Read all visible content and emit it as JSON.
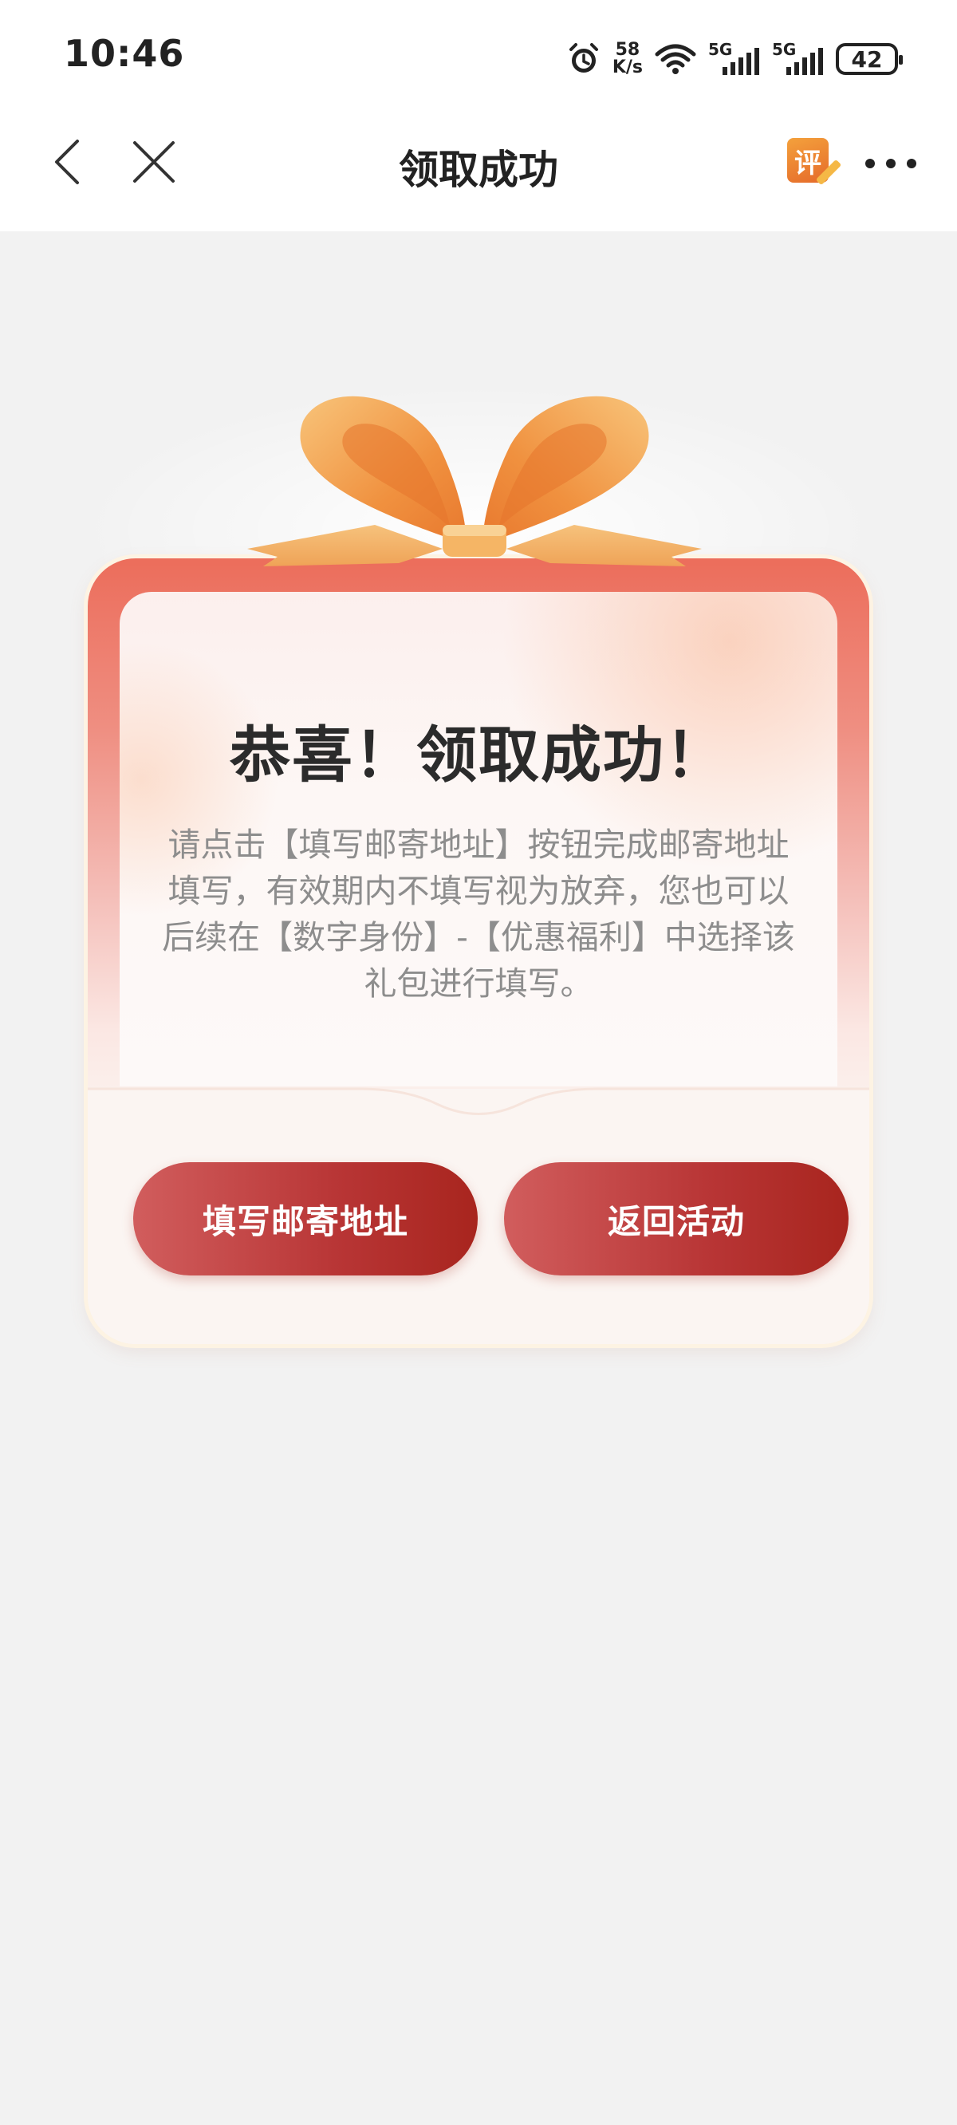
{
  "status_bar": {
    "time": "10:46",
    "net_speed_value": "58",
    "net_speed_unit": "K/s",
    "signal1_label": "5G",
    "signal2_label": "5G",
    "battery": "42"
  },
  "nav": {
    "title": "领取成功",
    "review_icon_text": "评"
  },
  "card": {
    "title": "恭喜！领取成功！",
    "description": "请点击【填写邮寄地址】按钮完成邮寄地址填写，有效期内不填写视为放弃，您也可以后续在【数字身份】-【优惠福利】中选择该礼包进行填写。",
    "primary_button": "填写邮寄地址",
    "secondary_button": "返回活动"
  },
  "colors": {
    "page_background": "#f2f2f2",
    "button_red": "#b83535",
    "card_top_red": "#ec6d5b",
    "ribbon_orange": "#f2a050"
  }
}
